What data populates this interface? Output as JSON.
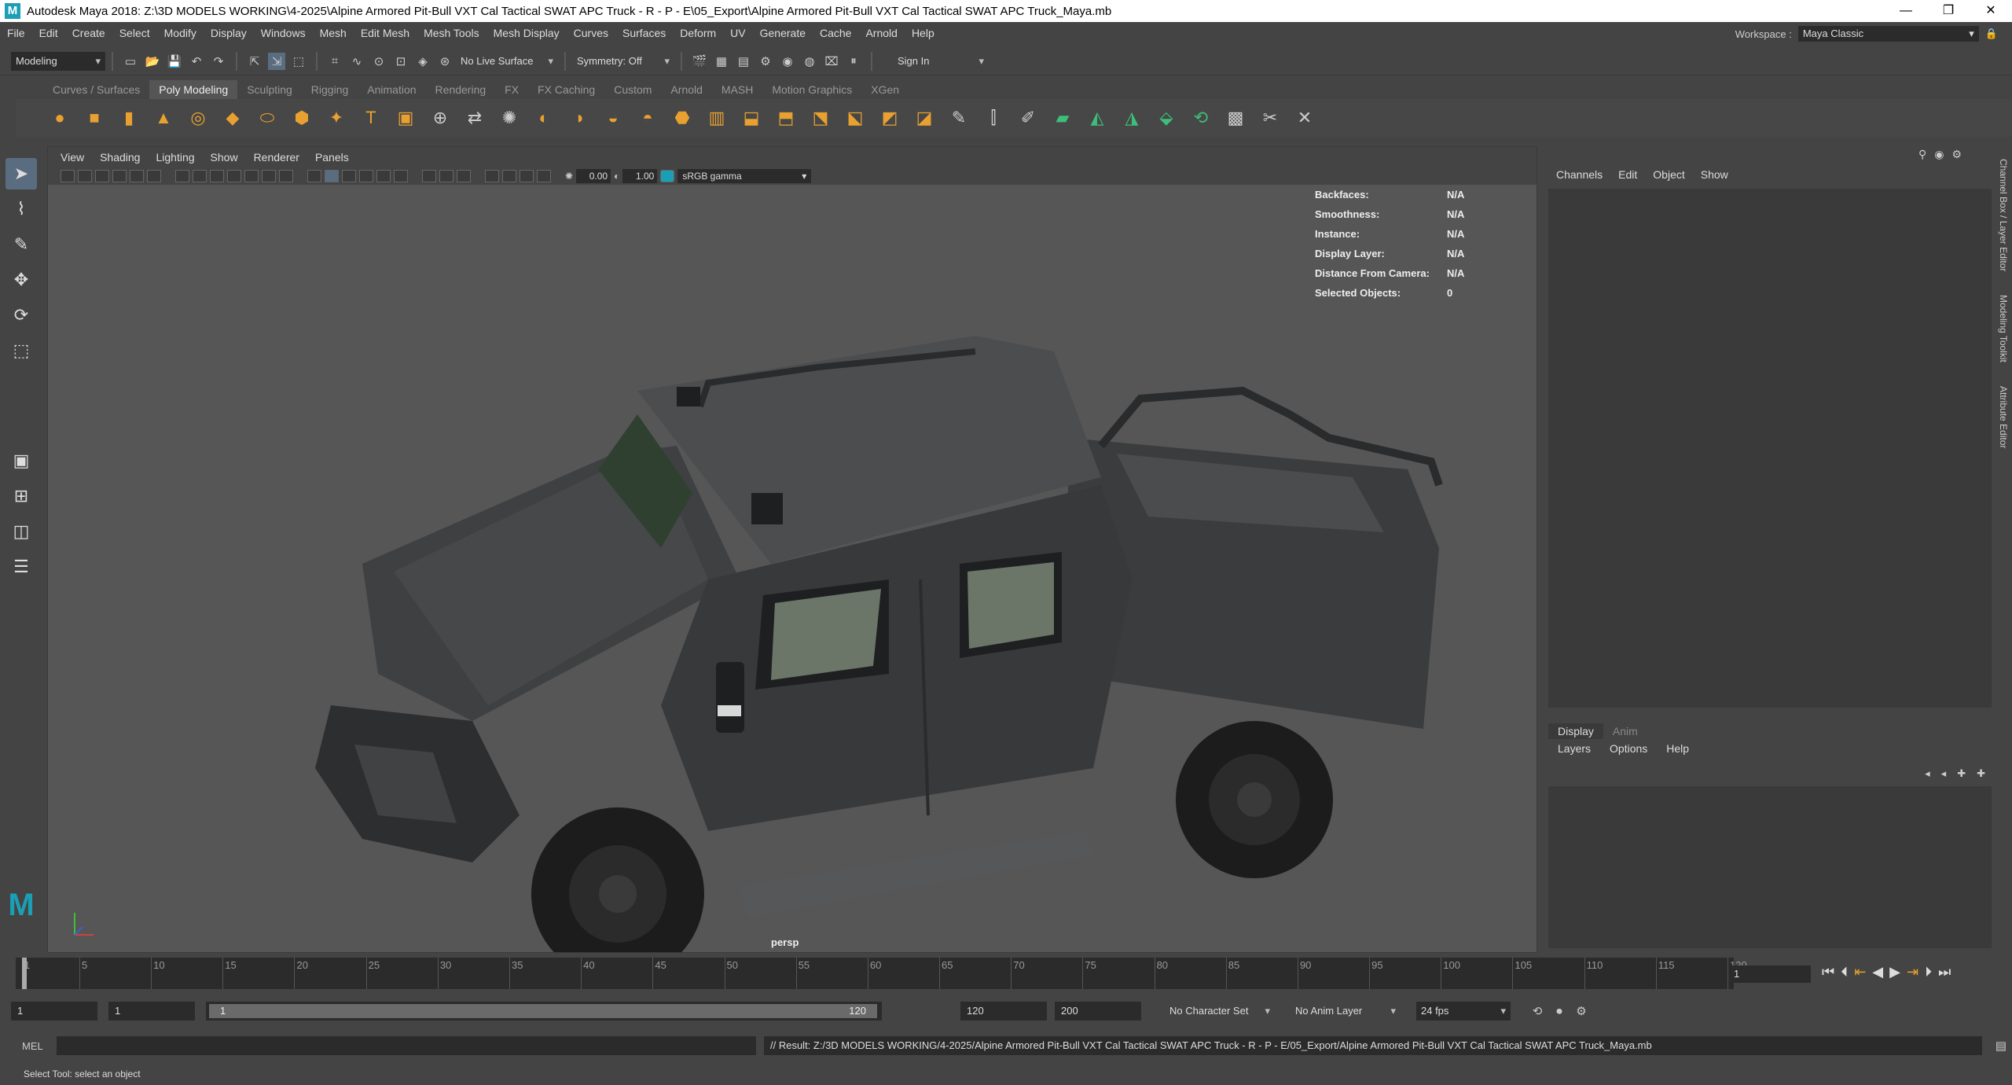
{
  "window": {
    "title": "Autodesk Maya 2018: Z:\\3D MODELS WORKING\\4-2025\\Alpine Armored Pit-Bull VXT Cal Tactical SWAT APC Truck - R - P - E\\05_Export\\Alpine Armored Pit-Bull VXT Cal Tactical SWAT APC Truck_Maya.mb",
    "controls": [
      "—",
      "❐",
      "✕"
    ]
  },
  "menu": [
    "File",
    "Edit",
    "Create",
    "Select",
    "Modify",
    "Display",
    "Windows",
    "Mesh",
    "Edit Mesh",
    "Mesh Tools",
    "Mesh Display",
    "Curves",
    "Surfaces",
    "Deform",
    "UV",
    "Generate",
    "Cache",
    "Arnold",
    "Help"
  ],
  "workspace": {
    "label": "Workspace :",
    "value": "Maya Classic"
  },
  "status": {
    "mode": "Modeling",
    "live_surface": "No Live Surface",
    "symmetry": "Symmetry: Off",
    "sign_in": "Sign In"
  },
  "shelf_tabs": [
    "Curves / Surfaces",
    "Poly Modeling",
    "Sculpting",
    "Rigging",
    "Animation",
    "Rendering",
    "FX",
    "FX Caching",
    "Custom",
    "Arnold",
    "MASH",
    "Motion Graphics",
    "XGen"
  ],
  "shelf_active": "Poly Modeling",
  "viewport": {
    "menu": [
      "View",
      "Shading",
      "Lighting",
      "Show",
      "Renderer",
      "Panels"
    ],
    "exposure": "0.00",
    "gamma_value": "1.00",
    "color_space": "sRGB gamma",
    "camera": "persp",
    "hud": [
      {
        "k": "Backfaces:",
        "v": "N/A"
      },
      {
        "k": "Smoothness:",
        "v": "N/A"
      },
      {
        "k": "Instance:",
        "v": "N/A"
      },
      {
        "k": "Display Layer:",
        "v": "N/A"
      },
      {
        "k": "Distance From Camera:",
        "v": "N/A"
      },
      {
        "k": "Selected Objects:",
        "v": "0"
      }
    ]
  },
  "channel_box": {
    "tabs": [
      "Channels",
      "Edit",
      "Object",
      "Show"
    ]
  },
  "layer_editor": {
    "tabs": [
      "Display",
      "Anim"
    ],
    "active": "Display",
    "menu": [
      "Layers",
      "Options",
      "Help"
    ]
  },
  "side_tabs": [
    "Channel Box / Layer Editor",
    "Modeling Toolkit",
    "Attribute Editor"
  ],
  "timeline": {
    "ticks": [
      "1",
      "5",
      "10",
      "15",
      "20",
      "25",
      "30",
      "35",
      "40",
      "45",
      "50",
      "55",
      "60",
      "65",
      "70",
      "75",
      "80",
      "85",
      "90",
      "95",
      "100",
      "105",
      "110",
      "115",
      "120"
    ],
    "current_frame": "1"
  },
  "range": {
    "start": "1",
    "playback_start": "1",
    "slider_start": "1",
    "slider_end": "120",
    "playback_end": "120",
    "end": "200",
    "character_set": "No Character Set",
    "anim_layer": "No Anim Layer",
    "fps": "24 fps"
  },
  "command": {
    "lang": "MEL",
    "result": "// Result: Z:/3D MODELS WORKING/4-2025/Alpine Armored Pit-Bull VXT Cal Tactical SWAT APC Truck - R - P - E/05_Export/Alpine Armored Pit-Bull VXT Cal Tactical SWAT APC Truck_Maya.mb"
  },
  "help_line": "Select Tool: select an object",
  "colors": {
    "accent": "#5a6c80",
    "maya_logo": "#1a9fb5",
    "shelf_orange": "#e8a030"
  }
}
